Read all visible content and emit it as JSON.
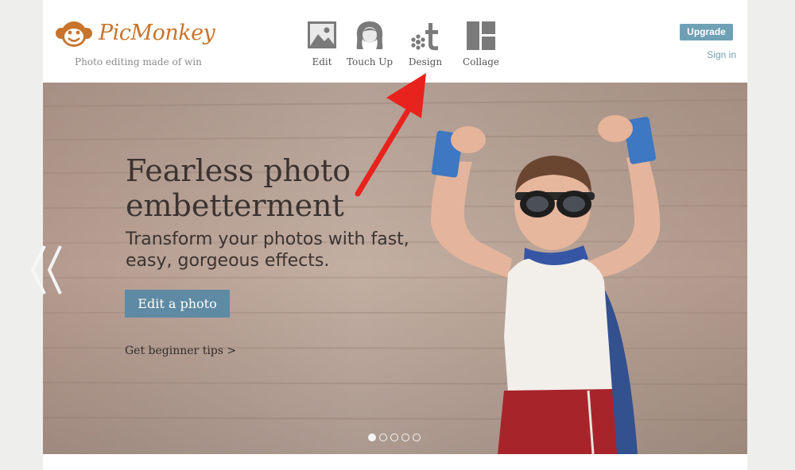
{
  "brand": {
    "name": "PicMonkey",
    "tagline": "Photo editing made of win",
    "color": "#c8742d"
  },
  "nav": {
    "items": [
      {
        "label": "Edit",
        "icon": "image-icon"
      },
      {
        "label": "Touch Up",
        "icon": "face-icon"
      },
      {
        "label": "Design",
        "icon": "design-icon"
      },
      {
        "label": "Collage",
        "icon": "collage-icon"
      }
    ]
  },
  "account": {
    "upgrade_label": "Upgrade",
    "signin_label": "Sign in",
    "accent_color": "#6fa0b5"
  },
  "hero": {
    "title": "Fearless photo embetterment",
    "subtitle": "Transform your photos with fast, easy, gorgeous effects.",
    "cta_label": "Edit a photo",
    "tips_label": "Get beginner tips >",
    "slide_count": 5,
    "active_slide": 1,
    "cta_color": "#5e8aa3"
  },
  "annotation": {
    "arrow_color": "#e8231d",
    "points_to": "Design"
  }
}
